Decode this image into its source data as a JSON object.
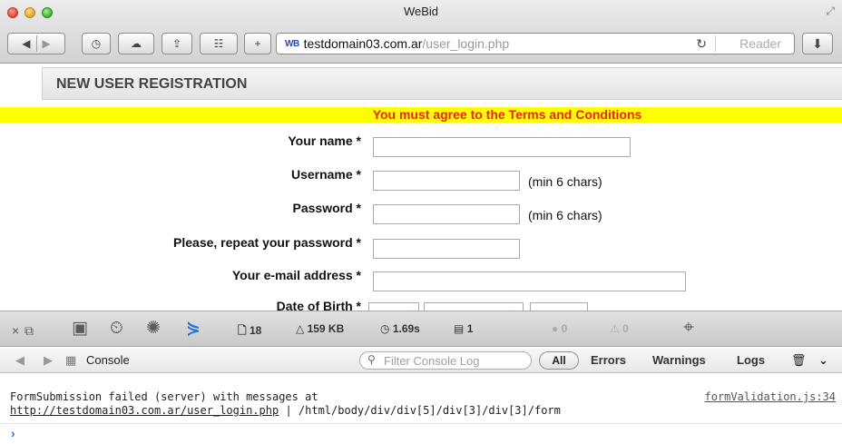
{
  "window": {
    "title": "WeBid"
  },
  "toolbar": {
    "address_favicon": "WB",
    "address_domain": "testdomain03.com.ar",
    "address_path": "/user_login.php",
    "reader_label": "Reader"
  },
  "page": {
    "header_title": "NEW USER REGISTRATION",
    "error_message": "You must agree to the Terms and Conditions",
    "fields": [
      {
        "label": "Your name *",
        "value": "",
        "hint": ""
      },
      {
        "label": "Username *",
        "value": "",
        "hint": "(min 6 chars)"
      },
      {
        "label": "Password *",
        "value": "",
        "hint": "(min 6 chars)"
      },
      {
        "label": "Please, repeat your password *",
        "value": "",
        "hint": ""
      },
      {
        "label": "Your e-mail address *",
        "value": "",
        "hint": ""
      },
      {
        "label": "Date of Birth *",
        "value": "",
        "hint": ""
      }
    ]
  },
  "devtools": {
    "resources_count": "18",
    "size": "159 KB",
    "load_time": "1.69s",
    "log_count": "1",
    "error_count": "0",
    "warning_count": "0"
  },
  "console": {
    "tab_label": "Console",
    "filter_placeholder": "Filter Console Log",
    "filters": [
      "All",
      "Errors",
      "Warnings",
      "Logs"
    ],
    "log_message": "FormSubmission failed (server) with messages at",
    "log_source": "formValidation.js:34",
    "log_url": "http://testdomain03.com.ar/user_login.php",
    "log_xpath": " | /html/body/div/div[5]/div[3]/div[3]/form",
    "prompt": "›"
  }
}
